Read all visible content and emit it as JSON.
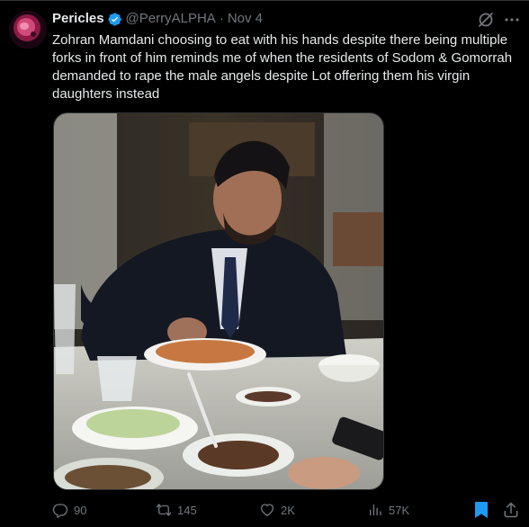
{
  "tweet": {
    "author_name": "Pericles",
    "author_handle": "@PerryALPHA",
    "separator": "·",
    "date": "Nov 4",
    "text": "Zohran Mamdani choosing to eat with his hands despite there being multiple forks in front of him reminds me of when the residents of Sodom & Gomorrah demanded to rape the male angels despite Lot offering them his virgin daughters instead"
  },
  "actions": {
    "replies": "90",
    "retweets": "145",
    "likes": "2K",
    "views": "57K"
  },
  "icons": {
    "verified": "verified-badge-icon",
    "grok": "grok-icon",
    "more": "more-options-icon",
    "reply": "reply-icon",
    "retweet": "retweet-icon",
    "like": "heart-icon",
    "views": "views-chart-icon",
    "bookmark": "bookmark-icon",
    "share": "share-icon"
  },
  "colors": {
    "background": "#000000",
    "text_primary": "#e7e9ea",
    "text_secondary": "#71767b",
    "accent_blue": "#1d9bf0",
    "border": "#2f3336"
  }
}
